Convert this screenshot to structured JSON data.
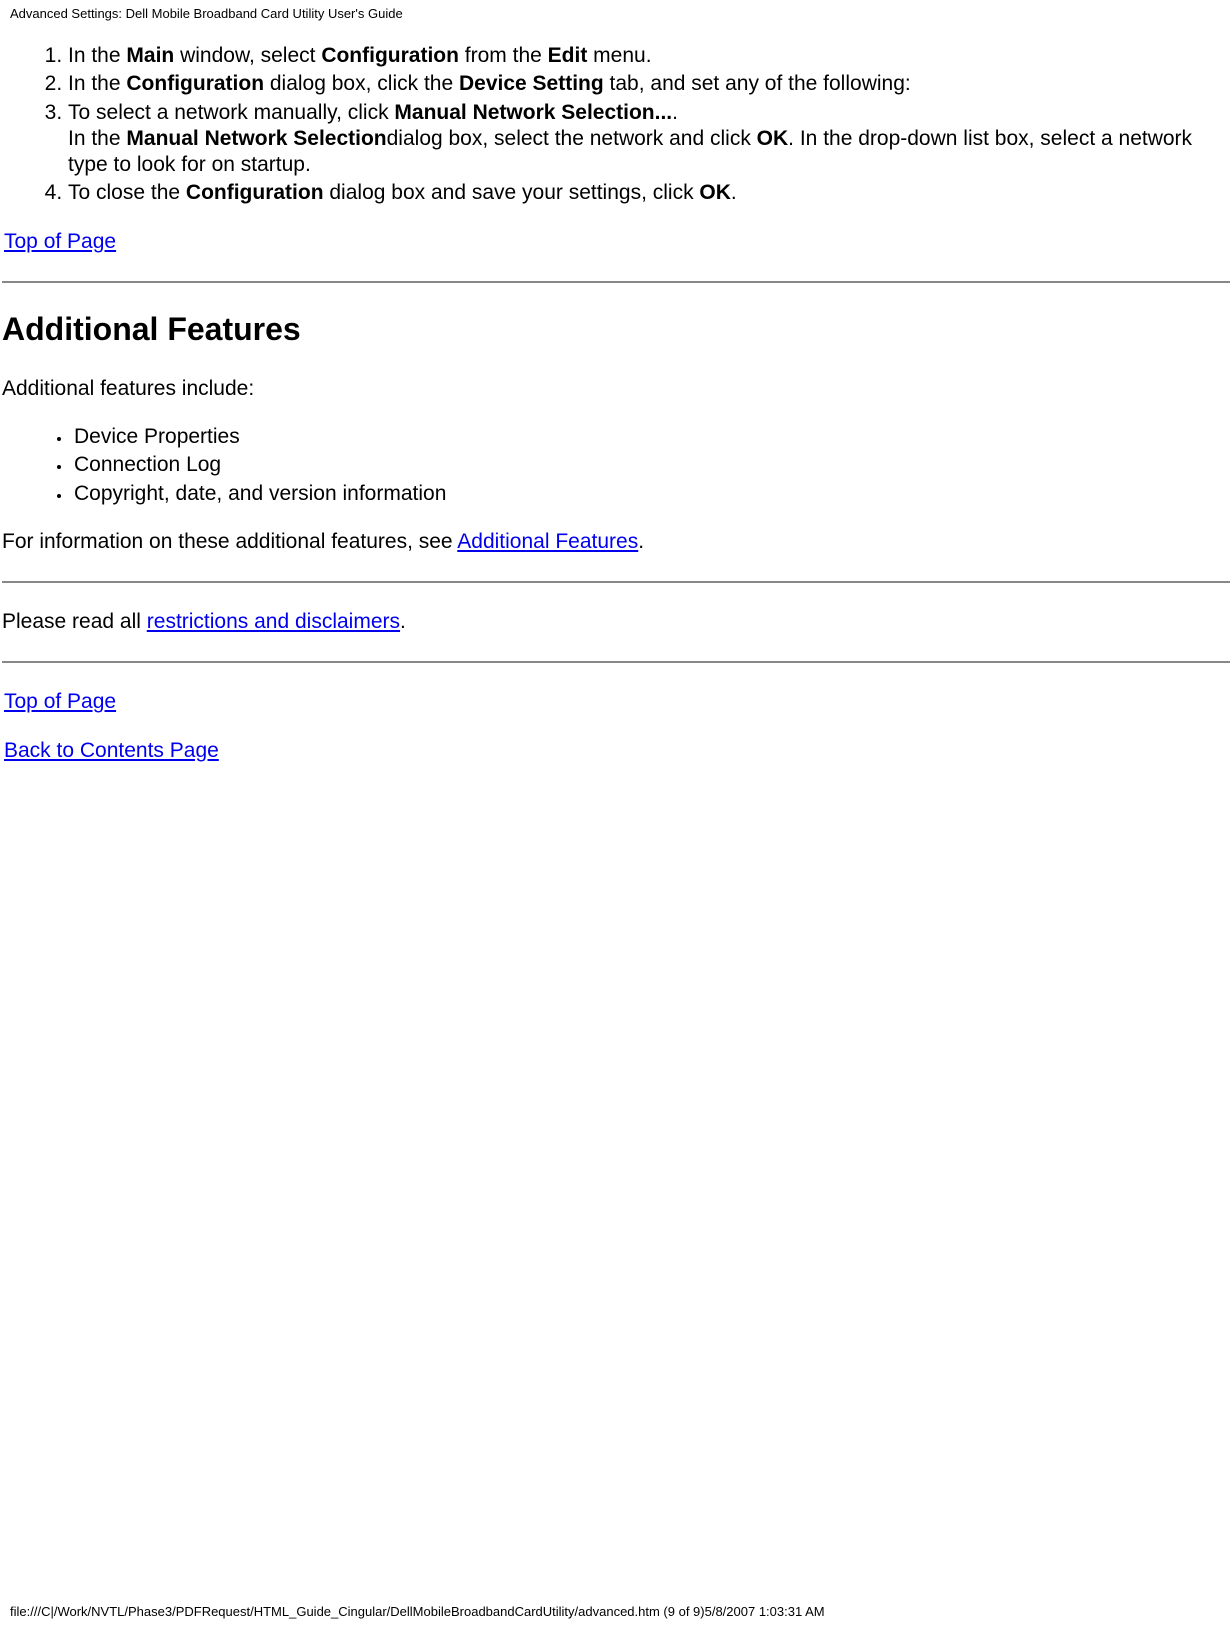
{
  "header": "Advanced Settings: Dell Mobile Broadband Card Utility User's Guide",
  "steps": {
    "s1": {
      "t1": "In the ",
      "b1": "Main",
      "t2": " window, select ",
      "b2": "Configuration",
      "t3": " from the ",
      "b3": "Edit",
      "t4": " menu."
    },
    "s2": {
      "t1": "In the ",
      "b1": "Configuration",
      "t2": " dialog box, click the ",
      "b2": "Device Setting",
      "t3": " tab, and set any of the following:"
    },
    "s3": {
      "t1": "To select a network manually, click ",
      "b1": "Manual Network Selection...",
      "t2": ".",
      "t3": "In the ",
      "b2": "Manual Network Selection",
      "t4": "dialog box, select the network and click ",
      "b3": "OK",
      "t5": ". In the drop-down list box, select a network type to look for on startup."
    },
    "s4": {
      "t1": "To close the ",
      "b1": "Configuration",
      "t2": " dialog box and save your settings, click ",
      "b2": "OK",
      "t3": "."
    }
  },
  "links": {
    "top1": "Top of Page",
    "additional": "Additional Features",
    "restrictions": "restrictions and disclaimers",
    "top2": "Top of Page",
    "back": "Back to Contents Page"
  },
  "h2": "Additional Features",
  "p_intro": "Additional features include:",
  "bullets": {
    "b1": "Device Properties",
    "b2": "Connection Log",
    "b3": "Copyright, date, and version information"
  },
  "p_seeinfo_pre": "For information on these additional features, see ",
  "p_seeinfo_post": ".",
  "p_restrict_pre": "Please read all ",
  "p_restrict_post": ".",
  "footer": "file:///C|/Work/NVTL/Phase3/PDFRequest/HTML_Guide_Cingular/DellMobileBroadbandCardUtility/advanced.htm (9 of 9)5/8/2007 1:03:31 AM"
}
